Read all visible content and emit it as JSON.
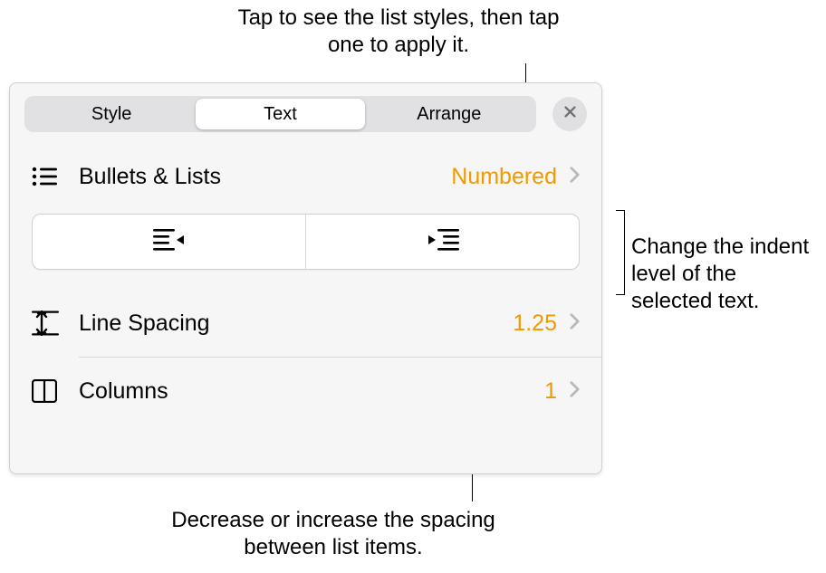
{
  "callouts": {
    "top": "Tap to see the list styles, then tap one to apply it.",
    "right": "Change the indent level of the selected text.",
    "bottom": "Decrease or increase the spacing between list items."
  },
  "tabs": {
    "style": "Style",
    "text": "Text",
    "arrange": "Arrange"
  },
  "rows": {
    "bullets": {
      "label": "Bullets & Lists",
      "value": "Numbered"
    },
    "line_spacing": {
      "label": "Line Spacing",
      "value": "1.25"
    },
    "columns": {
      "label": "Columns",
      "value": "1"
    }
  },
  "icons": {
    "close": "close-icon",
    "list": "list-icon",
    "outdent": "outdent-icon",
    "indent": "indent-icon",
    "line_spacing": "line-spacing-icon",
    "columns": "columns-icon",
    "chevron": "chevron-right-icon"
  }
}
